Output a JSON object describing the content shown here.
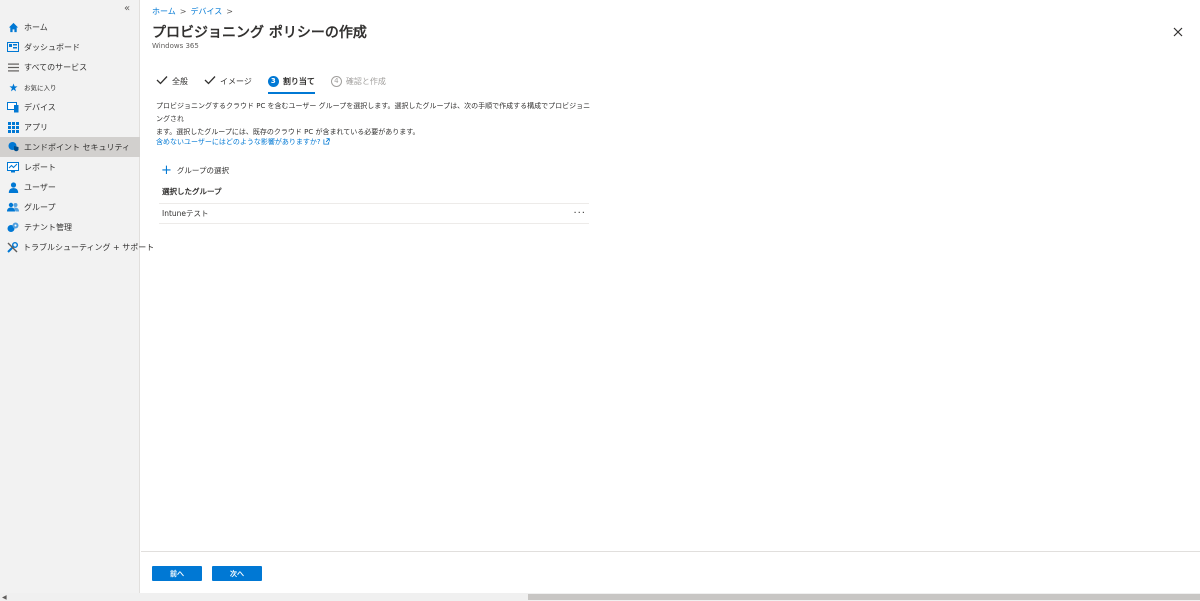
{
  "sidebar": {
    "collapse_label": "«",
    "items": [
      {
        "label": "ホーム",
        "icon": "home-icon",
        "color": "#0078d4"
      },
      {
        "label": "ダッシュボード",
        "icon": "dashboard-icon",
        "color": "#0078d4"
      },
      {
        "label": "すべてのサービス",
        "icon": "list-icon",
        "color": "#605e5c"
      },
      {
        "label": "お気に入り",
        "icon": "star-icon",
        "color": "#0078d4"
      },
      {
        "label": "デバイス",
        "icon": "device-icon",
        "color": "#0078d4"
      },
      {
        "label": "アプリ",
        "icon": "apps-icon",
        "color": "#0078d4"
      },
      {
        "label": "エンドポイント セキュリティ",
        "icon": "shield-icon",
        "color": "#0078d4"
      },
      {
        "label": "レポート",
        "icon": "report-icon",
        "color": "#0078d4"
      },
      {
        "label": "ユーザー",
        "icon": "user-icon",
        "color": "#0078d4"
      },
      {
        "label": "グループ",
        "icon": "group-icon",
        "color": "#0078d4"
      },
      {
        "label": "テナント管理",
        "icon": "tenant-icon",
        "color": "#0078d4"
      },
      {
        "label": "トラブルシューティング + サポート",
        "icon": "wrench-icon",
        "color": "#0078d4"
      }
    ]
  },
  "breadcrumb": {
    "home": "ホーム",
    "separator": ">",
    "devices": "デバイス"
  },
  "header": {
    "title": "プロビジョニング ポリシーの作成",
    "more": "···",
    "subtitle": "Windows 365"
  },
  "steps": [
    {
      "label": "全般",
      "state": "done"
    },
    {
      "label": "イメージ",
      "state": "done"
    },
    {
      "number": "3",
      "label": "割り当て",
      "state": "active"
    },
    {
      "number": "4",
      "label": "確認と作成",
      "state": "disabled"
    }
  ],
  "main": {
    "description_line1": "プロビジョニングするクラウド PC を含むユーザー グループを選択します。選択したグループは、次の手順で作成する構成でプロビジョニングされ",
    "description_line2": "ます。選択したグループには、既存のクラウド PC が含まれている必要があります。",
    "help_link": "含めないユーザーにはどのような影響がありますか?",
    "add_group_label": "グループの選択",
    "selected_groups_title": "選択したグループ",
    "groups": [
      {
        "name": "Intuneテスト",
        "more": "···"
      }
    ]
  },
  "footer": {
    "prev_label": "前へ",
    "next_label": "次へ"
  },
  "colors": {
    "accent": "#0078d4",
    "sidebar_bg": "#f2f2f2",
    "sidebar_active": "#d2d0ce"
  }
}
